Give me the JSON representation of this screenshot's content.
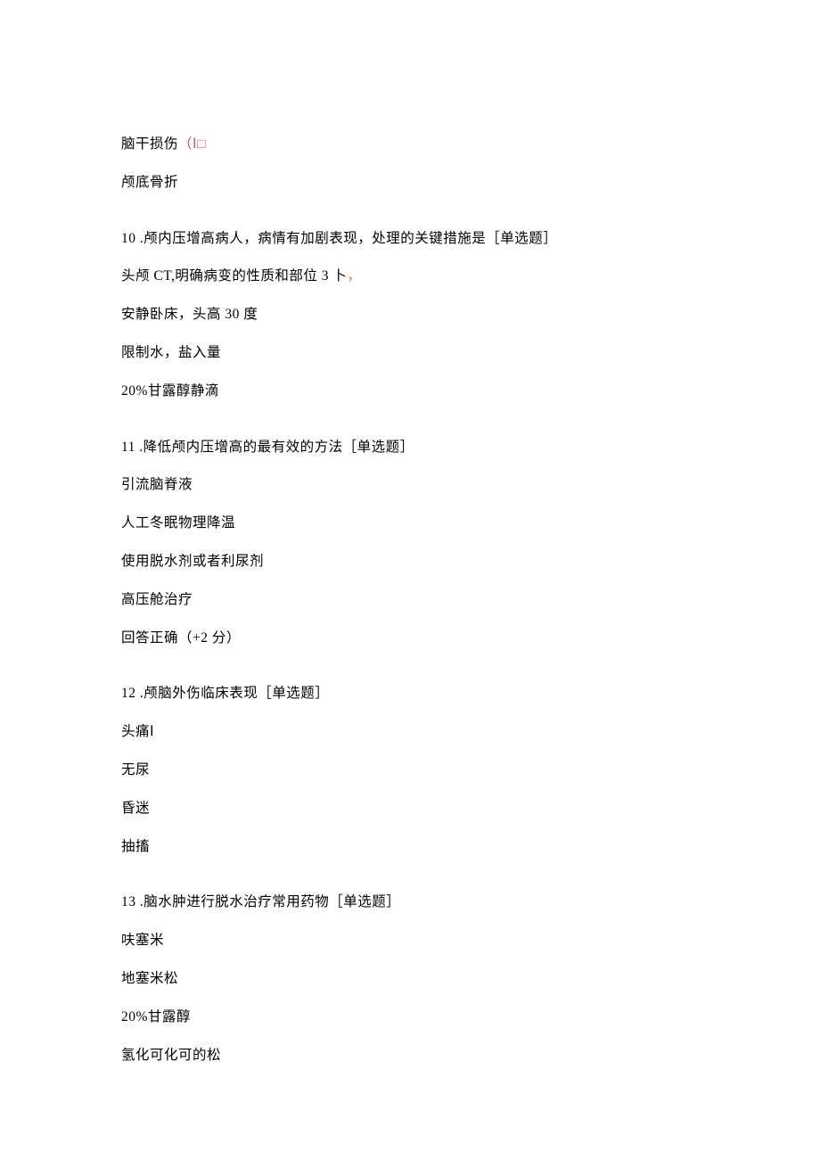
{
  "prior": {
    "a": {
      "pre": "脑干损伤",
      "colored": "（Ⅰ□"
    },
    "b": "颅底骨折"
  },
  "q10": {
    "stem": "10 .颅内压增高病人，病情有加剧表现，处理的关键措施是［单选题］",
    "a_pre": "头颅 CT,明确病变的性质和部位 3 卜",
    "a_mark": "，",
    "b": "安静卧床，头高 30 度",
    "c": "限制水，盐入量",
    "d": "20%甘露醇静滴"
  },
  "q11": {
    "stem": "11 .降低颅内压增高的最有效的方法［单选题］",
    "a": "引流脑脊液",
    "b": "人工冬眠物理降温",
    "c": "使用脱水剂或者利尿剂",
    "d": "高压舱治疗",
    "e": "回答正确（+2 分）"
  },
  "q12": {
    "stem": "12 .颅脑外伤临床表现［单选题］",
    "a": "头痛Ⅰ",
    "b": "无尿",
    "c": "昏迷",
    "d": "抽搐"
  },
  "q13": {
    "stem": "13 .脑水肿进行脱水治疗常用药物［单选题］",
    "a": "呋塞米",
    "b": "地塞米松",
    "c": "20%甘露醇",
    "d": "氢化可化可的松"
  }
}
